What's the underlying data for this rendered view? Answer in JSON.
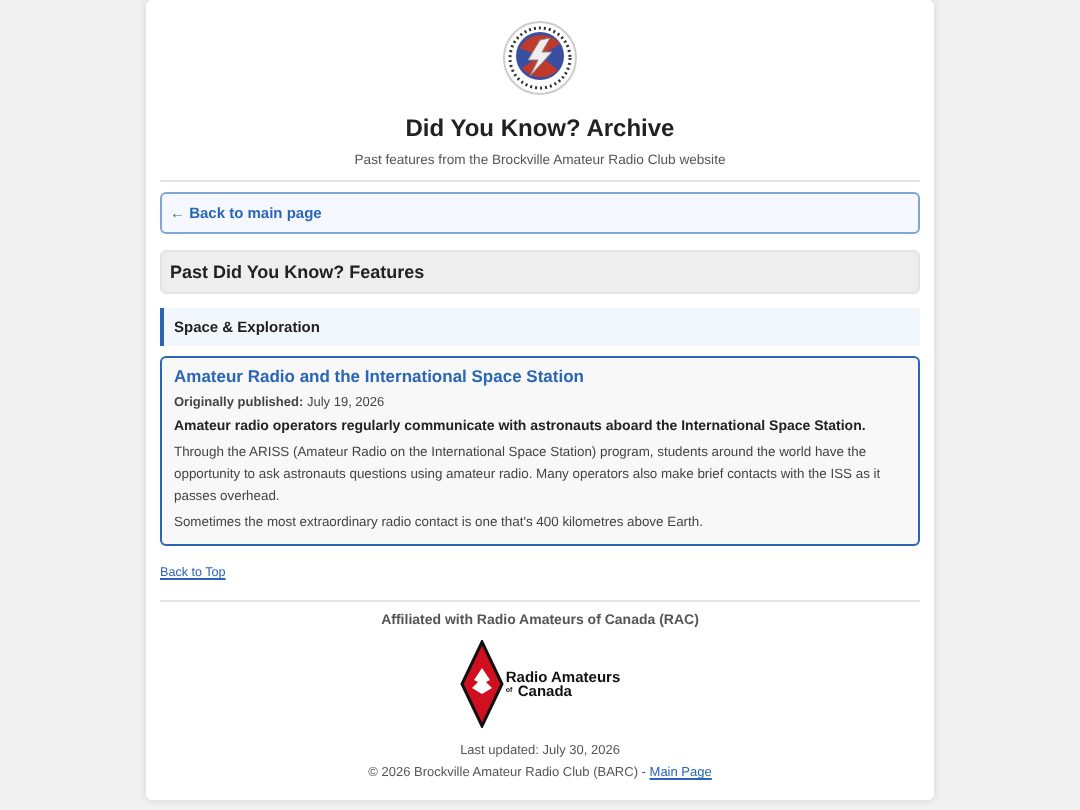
{
  "header": {
    "title": "Did You Know? Archive",
    "subtitle": "Past features from the Brockville Amateur Radio Club website"
  },
  "back_link": {
    "label": "← Back to main page"
  },
  "section": {
    "title": "Past Did You Know? Features"
  },
  "categories": [
    {
      "title": "Space & Exploration",
      "articles": [
        {
          "title": "Amateur Radio and the International Space Station",
          "published_label": "Originally published:",
          "published_date": "July 19, 2026",
          "lead": "Amateur radio operators regularly communicate with astronauts aboard the International Space Station.",
          "paragraphs": [
            "Through the ARISS (Amateur Radio on the International Space Station) program, students around the world have the opportunity to ask astronauts questions using amateur radio. Many operators also make brief contacts with the ISS as it passes overhead.",
            "Sometimes the most extraordinary radio contact is one that's 400 kilometres above Earth."
          ]
        }
      ]
    }
  ],
  "back_to_top": "Back to Top",
  "footer": {
    "affiliation": "Affiliated with Radio Amateurs of Canada (RAC)",
    "rac_logo_lines": [
      "Radio Amateurs",
      "of",
      "Canada"
    ],
    "last_updated": "Last updated: July 30, 2026",
    "copyright": "© 2026 Brockville Amateur Radio Club (BARC) -",
    "main_link": "Main Page"
  }
}
